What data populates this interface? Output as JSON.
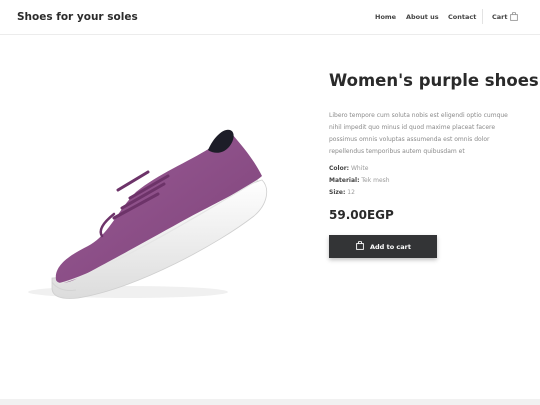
{
  "header": {
    "brand": "Shoes for your soles",
    "nav": [
      "Home",
      "About us",
      "Contact"
    ],
    "cart_label": "Cart",
    "cart_icon": "shopping-bag-icon"
  },
  "product": {
    "image_icon": "purple-sneaker-image",
    "title": "Women's purple shoes",
    "description": "Libero tempore cum soluta nobis est eligendi optio cumque nihil impedit quo minus id quod maxime placeat facere possimus omnis voluptas assumenda est omnis dolor repellendus temporibus autem quibusdam et",
    "attributes": [
      {
        "label": "Color:",
        "value": "White"
      },
      {
        "label": "Material:",
        "value": "Tek mesh"
      },
      {
        "label": "Size:",
        "value": "12"
      }
    ],
    "price": "59.00EGP",
    "add_to_cart": "Add to cart",
    "button_icon": "shopping-bag-icon"
  },
  "colors": {
    "shoe": "#8e4f8a",
    "button": "#333436"
  }
}
